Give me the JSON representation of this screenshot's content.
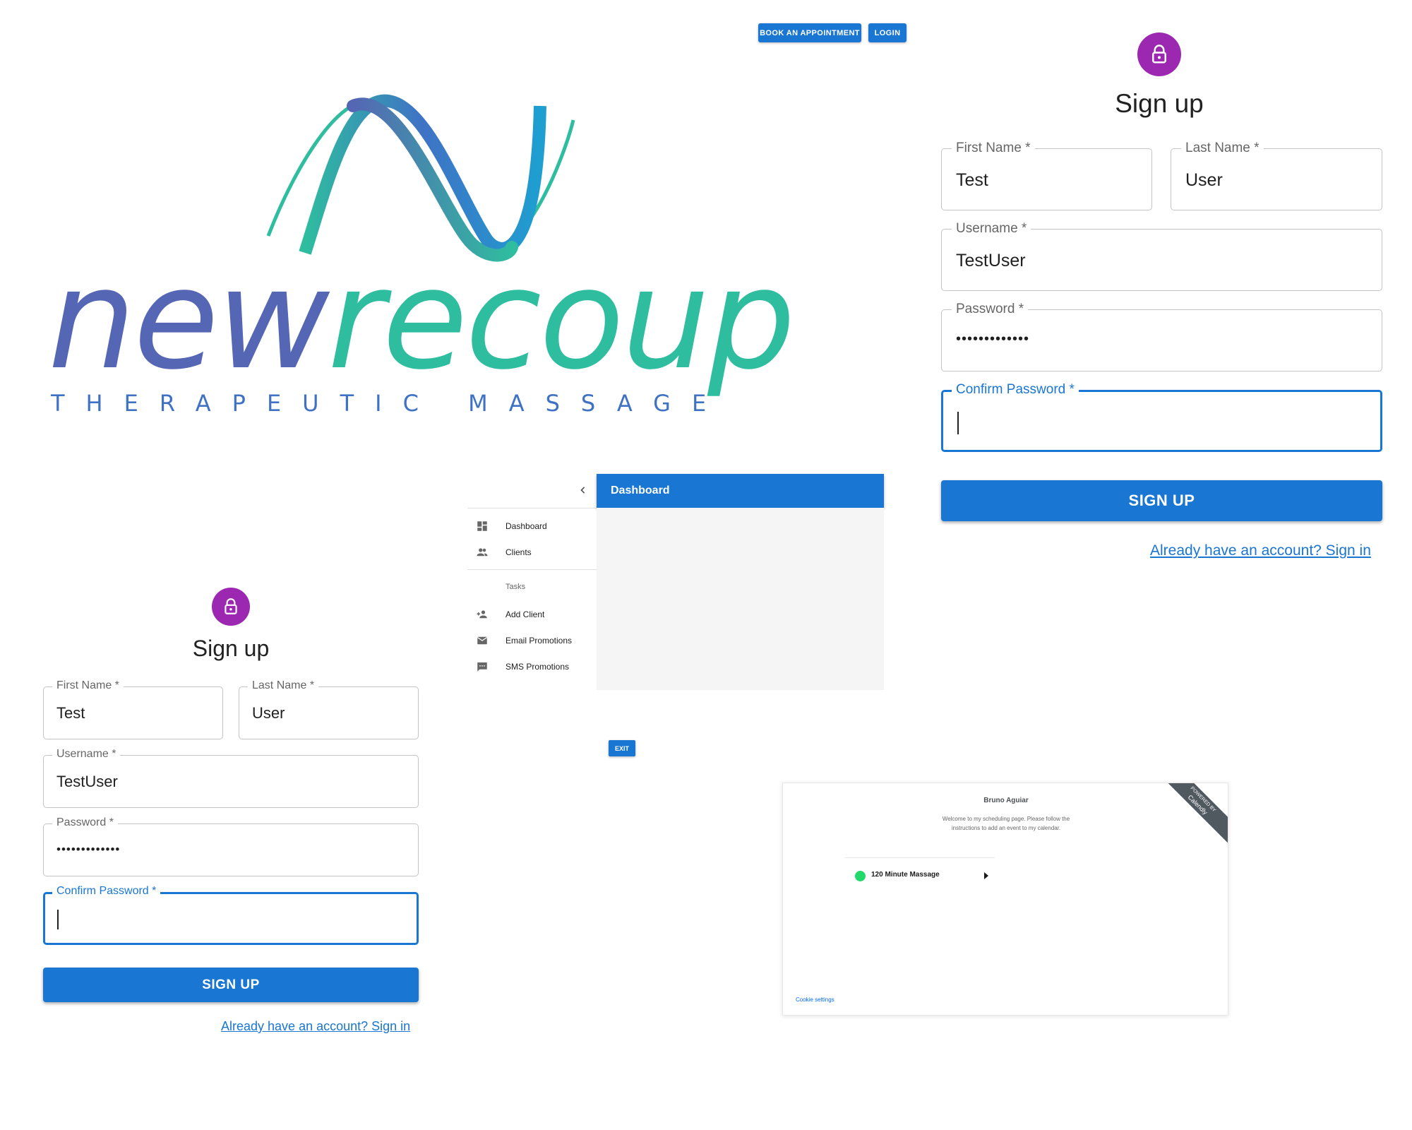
{
  "header": {
    "book_label": "BOOK AN APPOINTMENT",
    "login_label": "LOGIN"
  },
  "brand": {
    "word_part1": "new",
    "word_part2": "recoup",
    "tagline": "THERAPEUTIC MASSAGE",
    "colors": {
      "purple": "#5566b5",
      "teal": "#2fbd9f",
      "blue": "#3f72c5"
    }
  },
  "signup": {
    "title": "Sign up",
    "first_name_label": "First Name *",
    "first_name_value": "Test",
    "last_name_label": "Last Name *",
    "last_name_value": "User",
    "username_label": "Username *",
    "username_value": "TestUser",
    "password_label": "Password *",
    "password_value": "•••••••••••••",
    "confirm_label": "Confirm Password *",
    "confirm_value": "",
    "submit_label": "SIGN UP",
    "signin_link": "Already have an account? Sign in",
    "icon": "lock-icon",
    "accent": "#9c27b0",
    "primary": "#1976d2"
  },
  "dashboard": {
    "appbar_title": "Dashboard",
    "collapse_icon": "chevron-left-icon",
    "nav_items": [
      {
        "label": "Dashboard",
        "icon": "dashboard-icon"
      },
      {
        "label": "Clients",
        "icon": "people-icon"
      }
    ],
    "section_header": "Tasks",
    "task_items": [
      {
        "label": "Add Client",
        "icon": "person-add-icon"
      },
      {
        "label": "Email Promotions",
        "icon": "mail-icon"
      },
      {
        "label": "SMS Promotions",
        "icon": "sms-icon"
      }
    ],
    "exit_label": "EXIT"
  },
  "calendly": {
    "name": "Bruno Aguiar",
    "description": "Welcome to my scheduling page. Please follow the instructions to add an event to my calendar.",
    "event_label": "120 Minute Massage",
    "event_color": "#22d86a",
    "cookie_label": "Cookie settings",
    "ribbon_top": "POWERED BY",
    "ribbon_bottom": "Calendly"
  }
}
